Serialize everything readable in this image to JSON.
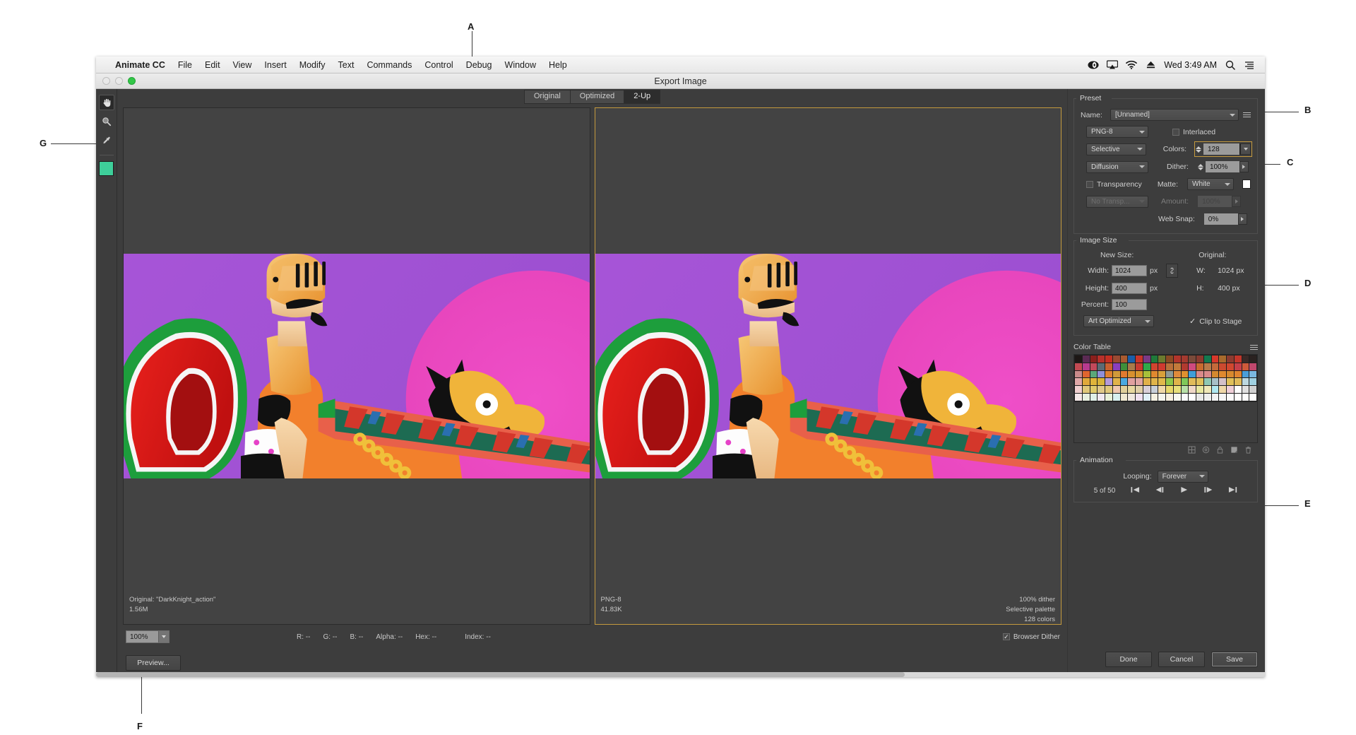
{
  "callouts": [
    {
      "id": "A",
      "label": "A"
    },
    {
      "id": "B",
      "label": "B"
    },
    {
      "id": "C",
      "label": "C"
    },
    {
      "id": "D",
      "label": "D"
    },
    {
      "id": "E",
      "label": "E"
    },
    {
      "id": "F",
      "label": "F"
    },
    {
      "id": "G",
      "label": "G"
    }
  ],
  "menubar": {
    "app": "Animate CC",
    "items": [
      "File",
      "Edit",
      "View",
      "Insert",
      "Modify",
      "Text",
      "Commands",
      "Control",
      "Debug",
      "Window",
      "Help"
    ],
    "time": "Wed 3:49 AM",
    "icons": [
      "creative-cloud-icon",
      "airplay-icon",
      "wifi-icon",
      "eject-icon",
      "spotlight-search-icon",
      "notification-center-icon"
    ]
  },
  "window": {
    "title": "Export Image"
  },
  "toolbar": {
    "tools": [
      {
        "name": "hand-tool",
        "label": "Hand Tool",
        "active": true
      },
      {
        "name": "zoom-tool",
        "label": "Zoom Tool",
        "active": false
      },
      {
        "name": "eyedropper-tool",
        "label": "Eyedropper Tool",
        "active": false
      }
    ],
    "swatch_color": "#3ecf9a"
  },
  "view_tabs": [
    {
      "label": "Original",
      "active": false
    },
    {
      "label": "Optimized",
      "active": false
    },
    {
      "label": "2-Up",
      "active": true
    }
  ],
  "panes": {
    "original": {
      "line1": "Original: \"DarkKnight_action\"",
      "line2": "1.56M",
      "right1": "",
      "right2": "",
      "right3": ""
    },
    "optimized": {
      "line1": "PNG-8",
      "line2": "41.83K",
      "right1": "100% dither",
      "right2": "Selective palette",
      "right3": "128 colors"
    }
  },
  "bottom_bar": {
    "zoom_level": "100%",
    "readouts": [
      {
        "key": "R:",
        "value": "--"
      },
      {
        "key": "G:",
        "value": "--"
      },
      {
        "key": "B:",
        "value": "--"
      },
      {
        "key": "Alpha:",
        "value": "--"
      },
      {
        "key": "Hex:",
        "value": "--"
      },
      {
        "key": "Index:",
        "value": "--"
      }
    ],
    "browser_dither_label": "Browser Dither",
    "browser_dither_checked": true
  },
  "buttons": {
    "preview": "Preview...",
    "done": "Done",
    "cancel": "Cancel",
    "save": "Save"
  },
  "preset": {
    "group_title": "Preset",
    "name_label": "Name:",
    "name_value": "[Unnamed]",
    "format_value": "PNG-8",
    "interlaced_label": "Interlaced",
    "interlaced_checked": false,
    "palette_value": "Selective",
    "colors_label": "Colors:",
    "colors_value": "128",
    "dither_method_value": "Diffusion",
    "dither_label": "Dither:",
    "dither_value": "100%",
    "transparency_label": "Transparency",
    "transparency_checked": false,
    "matte_label": "Matte:",
    "matte_value": "White",
    "matte_color": "#ffffff",
    "transparency_dither_value": "No Transp...",
    "amount_label": "Amount:",
    "amount_value": "100%",
    "web_snap_label": "Web Snap:",
    "web_snap_value": "0%"
  },
  "image_size": {
    "group_title": "Image Size",
    "new_size_label": "New Size:",
    "original_label": "Original:",
    "width_label": "Width:",
    "width_value": "1024",
    "width_unit": "px",
    "height_label": "Height:",
    "height_value": "400",
    "height_unit": "px",
    "percent_label": "Percent:",
    "percent_value": "100",
    "quality_value": "Art Optimized",
    "orig_w_label": "W:",
    "orig_w_value": "1024 px",
    "orig_h_label": "H:",
    "orig_h_value": "400 px",
    "clip_to_stage_label": "Clip to Stage",
    "clip_to_stage_checked": true
  },
  "color_table": {
    "group_title": "Color Table",
    "swatches": [
      "#1d1715",
      "#5b2a53",
      "#8a1f1c",
      "#b8302a",
      "#c62f22",
      "#9b4a32",
      "#a95a2f",
      "#1a5ea8",
      "#c9352a",
      "#7a3a86",
      "#1f7a3a",
      "#6b7a2e",
      "#8b4a24",
      "#b2352b",
      "#a33a2f",
      "#7a4a3a",
      "#8a3a2f",
      "#13794f",
      "#d8382b",
      "#a86a2c",
      "#8c3b30",
      "#c3362a",
      "#3a2a28",
      "#2a2220",
      "#c24a52",
      "#b73a8f",
      "#c2495a",
      "#5c6a74",
      "#c9612f",
      "#8a3fbf",
      "#3f8f3a",
      "#a87a4a",
      "#c93a2f",
      "#2fa84a",
      "#d1452f",
      "#cf3a2f",
      "#b9703a",
      "#c27a3a",
      "#b23a2f",
      "#cf4a7f",
      "#c96a2f",
      "#b87a4a",
      "#c46a3a",
      "#cc4a2f",
      "#d1472f",
      "#c63f4a",
      "#cf5a3a",
      "#c0486d",
      "#c98a8a",
      "#e0652f",
      "#5aa87a",
      "#8f8fd8",
      "#e0802f",
      "#d09a3a",
      "#e07a2f",
      "#d9902f",
      "#d8982f",
      "#a7c03a",
      "#e0892f",
      "#d8a03a",
      "#8f9a94",
      "#e08a3a",
      "#e0912f",
      "#3f9ed8",
      "#d98a8a",
      "#d88a8a",
      "#d4892f",
      "#e0892f",
      "#d8892f",
      "#e0842f",
      "#4a9ed8",
      "#7ab8e0",
      "#e0a8a8",
      "#e0a93a",
      "#e0b43a",
      "#d8b43a",
      "#b49ad8",
      "#e0b24a",
      "#4aa8e0",
      "#e0a0a0",
      "#e0a5a5",
      "#e0b04a",
      "#e0b44a",
      "#e0b84a",
      "#90c84a",
      "#e0b44a",
      "#7fc85a",
      "#e0bb5a",
      "#e0c05a",
      "#8fc8b4",
      "#a8c0c8",
      "#d4c0c8",
      "#e0c05a",
      "#e0bb5a",
      "#bcd8e0",
      "#9fd0e0",
      "#f0cfcf",
      "#e0c87a",
      "#e0ca6a",
      "#e0c88a",
      "#e0c87a",
      "#f0c8b0",
      "#e0cf9a",
      "#e8d8a0",
      "#e0cfa8",
      "#d8cfd8",
      "#c8cfd8",
      "#f0d8a8",
      "#e8d86a",
      "#e8e07a",
      "#b8e0a8",
      "#f0d8c8",
      "#e8e8a0",
      "#f0e8b8",
      "#b0e8f0",
      "#f0d8a8",
      "#f0cfd8",
      "#ffffff",
      "#e0e0e0",
      "#d0d0d0",
      "#f4e8e8",
      "#e8f0e0",
      "#e0f0e8",
      "#f0e8f0",
      "#e8f0d8",
      "#d8f0f0",
      "#f0e8d0",
      "#f0e8e0",
      "#f0e0f0",
      "#e0f0f8",
      "#f4f0e0",
      "#f4f4ec",
      "#f8f0e0",
      "#f8f8f0",
      "#fafafa",
      "#ffffff",
      "#e8e8e8",
      "#eeeeee",
      "#f2f2f2",
      "#f6f6f6",
      "#fbfbfb",
      "#ffffff",
      "#fdfdfd",
      "#fefefe"
    ],
    "tool_icons": [
      "web-shift-icon",
      "web-snap-icon",
      "lock-color-icon",
      "new-color-icon",
      "delete-color-icon"
    ]
  },
  "animation": {
    "group_title": "Animation",
    "looping_label": "Looping:",
    "looping_value": "Forever",
    "frame_counter": "5 of 50",
    "controls": [
      "first-frame-button",
      "previous-frame-button",
      "play-button",
      "next-frame-button",
      "last-frame-button"
    ]
  }
}
